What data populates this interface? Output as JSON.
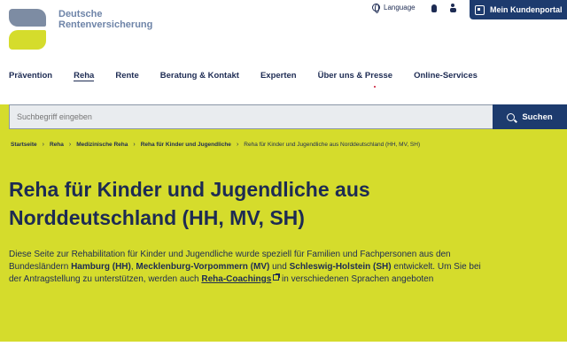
{
  "logo": {
    "line1": "Deutsche",
    "line2": "Rentenversicherung"
  },
  "utility": {
    "language": "Language",
    "portal": "Mein Kundenportal"
  },
  "nav": {
    "items": [
      {
        "label": "Prävention"
      },
      {
        "label": "Reha"
      },
      {
        "label": "Rente"
      },
      {
        "label": "Beratung & Kontakt"
      },
      {
        "label": "Experten"
      },
      {
        "label": "Über uns & Presse"
      },
      {
        "label": "Online-Services"
      }
    ]
  },
  "search": {
    "placeholder": "Suchbegriff eingeben",
    "button": "Suchen"
  },
  "breadcrumb": [
    {
      "label": "Startseite"
    },
    {
      "label": "Reha"
    },
    {
      "label": "Medizinische Reha"
    },
    {
      "label": "Reha für Kinder und Jugendliche"
    },
    {
      "label": "Reha für Kinder und Jugendliche aus Norddeutschland (HH, MV, SH)"
    }
  ],
  "page": {
    "title_line1": "Reha für Kinder und Jugendliche aus",
    "title_line2": "Norddeutschland (HH, MV, SH)",
    "intro": {
      "part1": "Diese Seite zur Rehabilitation für Kinder und Jugendliche wurde speziell für Familien und Fachpersonen aus den Bundesländern ",
      "hamburg": "Hamburg (HH)",
      "comma": ", ",
      "mv": "Mecklenburg-Vorpommern (MV)",
      "und": " und ",
      "sh": "Schleswig-Holstein (SH)",
      "part2": " entwickelt. Um Sie bei der Antragstellung zu unterstützen, werden auch ",
      "link": "Reha-Coachings",
      "part3": " in verschiedenen Sprachen angeboten"
    }
  },
  "colors": {
    "accent": "#d5dc2c",
    "primary": "#1d3b6e",
    "text": "#1d2b53"
  }
}
